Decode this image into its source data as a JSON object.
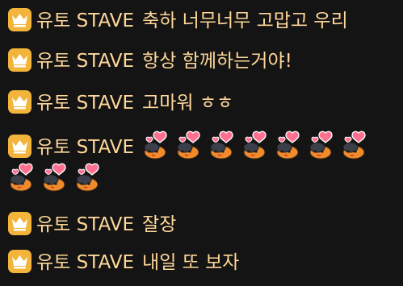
{
  "chat": {
    "messages": [
      {
        "user": "유토 STAVE",
        "text": "축하 너무너무 고맙고 우리"
      },
      {
        "user": "유토 STAVE",
        "text": "항상 함께하는거야!"
      },
      {
        "user": "유토 STAVE",
        "text": "고마워 ㅎㅎ"
      },
      {
        "user": "유토 STAVE",
        "text": "",
        "emotes": 10
      },
      {
        "user": "유토 STAVE",
        "text": "잘장"
      },
      {
        "user": "유토 STAVE",
        "text": "내일 또 보자"
      }
    ]
  },
  "colors": {
    "background": "#141414",
    "username": "#ffd79a",
    "badge": "#f2b43b",
    "crown": "#ffffff"
  },
  "icons": {
    "badge": "crown-icon",
    "emote": "heart-bear-emote"
  }
}
